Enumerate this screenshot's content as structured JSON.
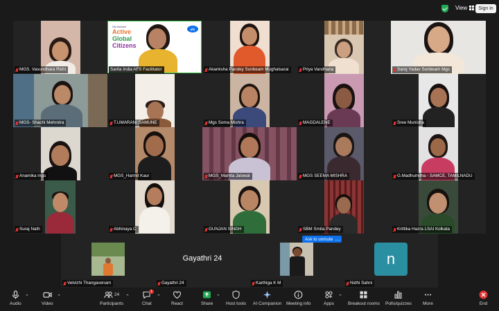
{
  "topbar": {
    "view_label": "View",
    "signin_label": "Sign in"
  },
  "participants": [
    {
      "name": "MGS. Vasundhara Rishi"
    },
    {
      "name": "Sarita India AFS Facilitator",
      "banner_line1": "Get Involved",
      "banner_words": [
        "Active",
        "Global",
        "Citizens"
      ],
      "logo": "afs"
    },
    {
      "name": "Akanksha Pandey Sunbeam Mughalsarai"
    },
    {
      "name": "Priya Vandhana"
    },
    {
      "name": "Saroj Yadav Sunbeam Mgs"
    },
    {
      "name": "MGS- Shachi Mehrotra"
    },
    {
      "name": "T.UMARANI SAMUNE"
    },
    {
      "name": "Mgs Soma Mishra"
    },
    {
      "name": "MAGDALENE"
    },
    {
      "name": "Sree Munisha"
    },
    {
      "name": "Anamika mgs"
    },
    {
      "name": "MGS_Harmit Kaur"
    },
    {
      "name": "MGS_Mamta Jaiswal"
    },
    {
      "name": "MGS SEEMA MISHRA"
    },
    {
      "name": "G.Madhumitha - SAMCE, TAMILNADU"
    },
    {
      "name": "Suraj Nath"
    },
    {
      "name": "Abhinaya C"
    },
    {
      "name": "GUNJAN SINGH"
    },
    {
      "name": "SBM Smita Pandey"
    },
    {
      "name": "Krittika Hazra LSAI Kolkata"
    }
  ],
  "bottom_strip": {
    "tiles": [
      {
        "name": "Velvizhi Thangavenam"
      },
      {
        "name": "Gayathri 24",
        "big_label": "Gayathri 24"
      },
      {
        "name": "Karthiga K M"
      },
      {
        "name": "Nidhi Sahni",
        "initial": "n"
      }
    ],
    "ask_unmute_label": "Ask to unmute",
    "more_label": "..."
  },
  "toolbar": {
    "audio": "Audio",
    "video": "Video",
    "participants": "Participants",
    "participants_count": "24",
    "chat": "Chat",
    "chat_badge": "1",
    "react": "React",
    "share": "Share",
    "host_tools": "Host tools",
    "ai_companion": "AI Companion",
    "meeting_info": "Meeting info",
    "apps": "Apps",
    "breakout_rooms": "Breakout rooms",
    "polls": "Polls/quizzes",
    "more": "More",
    "end": "End"
  },
  "colors": {
    "accent_blue": "#0e71eb",
    "mic_red": "#e23232",
    "shield_green": "#23a955",
    "end_red": "#e23232",
    "share_green": "#23a955",
    "active_speaker": "#3ec44b"
  }
}
